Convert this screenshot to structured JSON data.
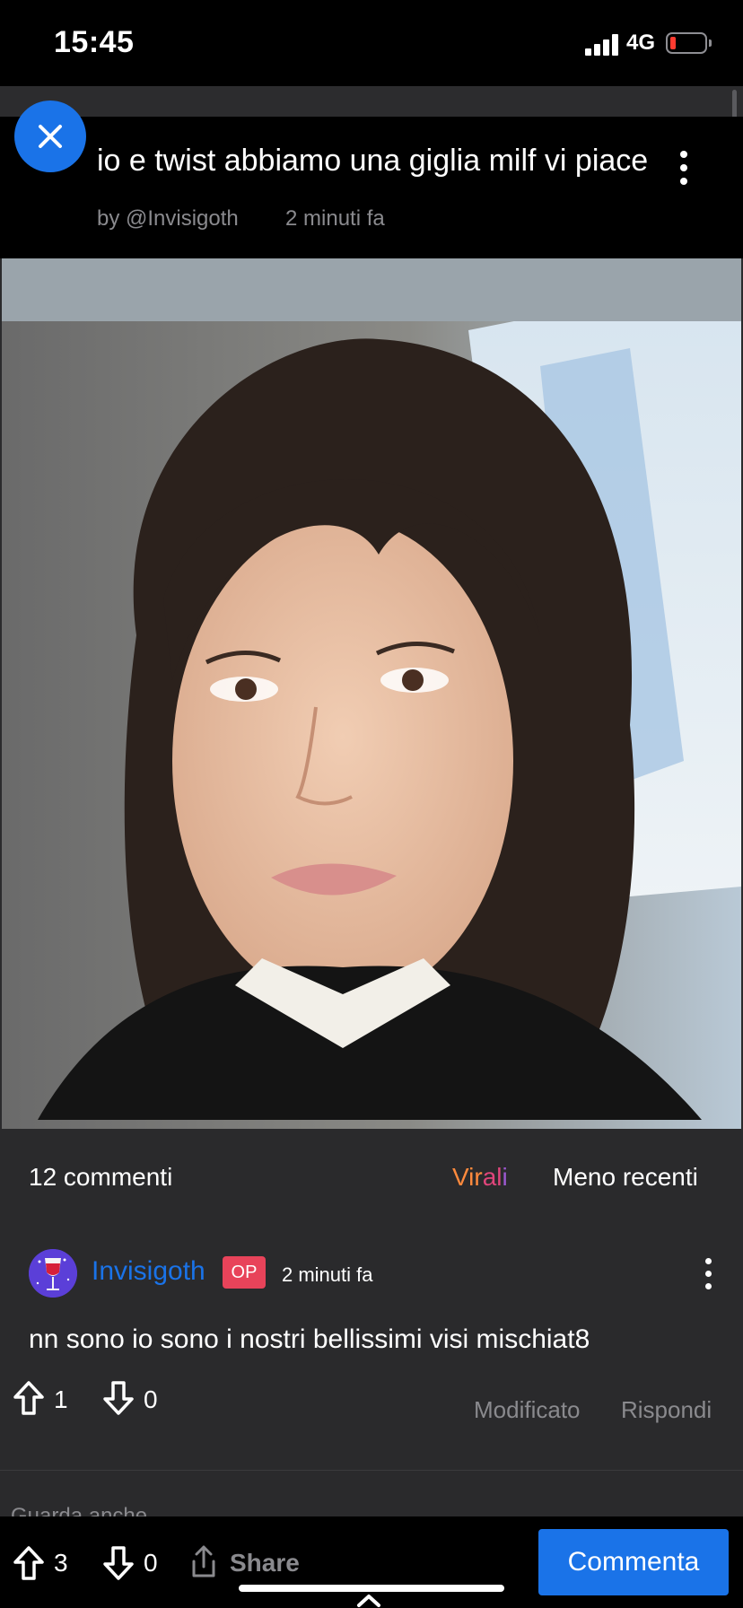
{
  "status_bar": {
    "time": "15:45",
    "network": "4G",
    "battery_level": 0.12,
    "battery_color": "#ff3b30"
  },
  "post": {
    "title": "io e twist abbiamo una giglia milf vi piace",
    "author": "by @Invisigoth",
    "time": "2 minuti fa",
    "image": "portrait photo of a woman with a dark wavy bob and bangs, black top with white collar"
  },
  "comments_header": {
    "count": "12 commenti",
    "sort_virali": [
      "Vir",
      "al",
      "i"
    ],
    "sort_recent": "Meno recenti"
  },
  "comment": {
    "author": "Invisigoth",
    "badge": "OP",
    "time": "2 minuti fa",
    "text": "nn sono io sono i nostri bellissimi visi mischiat8",
    "upvotes": "1",
    "downvotes": "0",
    "edited_label": "Modificato",
    "reply_label": "Rispondi"
  },
  "see_also": "Guarda anche",
  "bottom_bar": {
    "upvotes": "3",
    "downvotes": "0",
    "share_label": "Share",
    "comment_label": "Commenta"
  },
  "colors": {
    "accent": "#1a73e8",
    "op_badge": "#e8435a",
    "background": "#2a2a2c"
  }
}
